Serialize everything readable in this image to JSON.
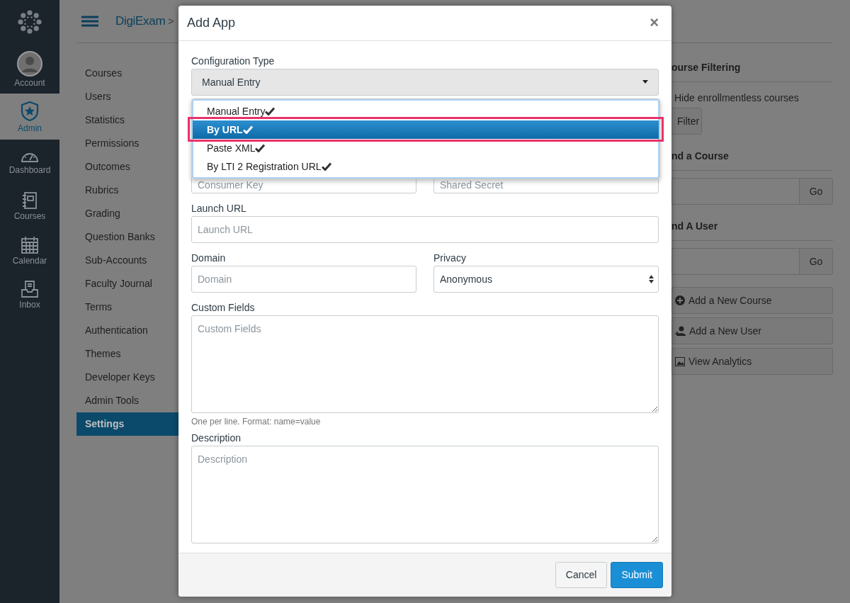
{
  "nav": [
    {
      "kind": "account",
      "label": "Account",
      "selected": false
    },
    {
      "kind": "admin",
      "label": "Admin",
      "selected": true
    },
    {
      "kind": "dashboard",
      "label": "Dashboard",
      "selected": false
    },
    {
      "kind": "courses",
      "label": "Courses",
      "selected": false
    },
    {
      "kind": "calendar",
      "label": "Calendar",
      "selected": false
    },
    {
      "kind": "inbox",
      "label": "Inbox",
      "selected": false
    }
  ],
  "breadcrumb": {
    "account": "DigiExam",
    "separator": ">"
  },
  "menu": [
    {
      "label": "Courses",
      "selected": false
    },
    {
      "label": "Users",
      "selected": false
    },
    {
      "label": "Statistics",
      "selected": false
    },
    {
      "label": "Permissions",
      "selected": false
    },
    {
      "label": "Outcomes",
      "selected": false
    },
    {
      "label": "Rubrics",
      "selected": false
    },
    {
      "label": "Grading",
      "selected": false
    },
    {
      "label": "Question Banks",
      "selected": false
    },
    {
      "label": "Sub-Accounts",
      "selected": false
    },
    {
      "label": "Faculty Journal",
      "selected": false
    },
    {
      "label": "Terms",
      "selected": false
    },
    {
      "label": "Authentication",
      "selected": false
    },
    {
      "label": "Themes",
      "selected": false
    },
    {
      "label": "Developer Keys",
      "selected": false
    },
    {
      "label": "Admin Tools",
      "selected": false
    },
    {
      "label": "Settings",
      "selected": true
    }
  ],
  "right": {
    "filter_heading": "ourse Filtering",
    "hide_label": "Hide enrollmentless courses",
    "filter_button": "Filter",
    "find_course_heading": "nd a Course",
    "find_course_button": "Go",
    "find_user_heading": "nd A User",
    "find_user_button": "Go",
    "actions": [
      {
        "kind": "add-course",
        "label": "Add a New Course"
      },
      {
        "kind": "add-user",
        "label": "Add a New User"
      },
      {
        "kind": "analytics",
        "label": "View Analytics"
      }
    ]
  },
  "modal": {
    "title": "Add App",
    "close": "×",
    "config_label": "Configuration Type",
    "config_value": "Manual Entry",
    "options": [
      {
        "label": "Manual Entry",
        "selected": false
      },
      {
        "label": "By URL",
        "selected": true
      },
      {
        "label": "Paste XML",
        "selected": false
      },
      {
        "label": "By LTI 2 Registration URL",
        "selected": false
      }
    ],
    "consumer_key_placeholder": "Consumer Key",
    "shared_secret_placeholder": "Shared Secret",
    "launch_label": "Launch URL",
    "launch_placeholder": "Launch URL",
    "domain_label": "Domain",
    "domain_placeholder": "Domain",
    "privacy_label": "Privacy",
    "privacy_value": "Anonymous",
    "custom_label": "Custom Fields",
    "custom_placeholder": "Custom Fields",
    "custom_hint": "One per line. Format: name=value",
    "description_label": "Description",
    "description_placeholder": "Description",
    "cancel": "Cancel",
    "submit": "Submit"
  }
}
